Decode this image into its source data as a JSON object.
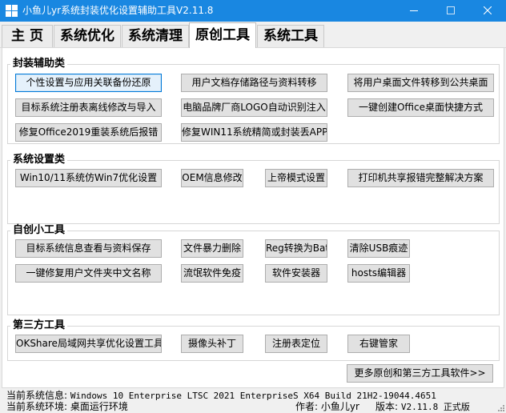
{
  "window": {
    "title": "小鱼儿yr系统封装优化设置辅助工具V2.11.8",
    "colors": {
      "titlebar": "#1987e1",
      "panel": "#ffffff",
      "button": "#e1e1e1",
      "focus": "#0078d7"
    }
  },
  "tabs": [
    {
      "label": "主 页",
      "active": false
    },
    {
      "label": "系统优化",
      "active": false
    },
    {
      "label": "系统清理",
      "active": false
    },
    {
      "label": "原创工具",
      "active": true
    },
    {
      "label": "系统工具",
      "active": false
    }
  ],
  "groups": {
    "packaging": {
      "title": "封装辅助类",
      "buttons": [
        "个性设置与应用关联备份还原",
        "用户文档存储路径与资料转移",
        "将用户桌面文件转移到公共桌面",
        "目标系统注册表离线修改与导入",
        "电脑品牌厂商LOGO自动识别注入",
        "一键创建Office桌面快捷方式",
        "修复Office2019重装系统后报错",
        "修复WIN11系统精简或封装丢APP"
      ]
    },
    "settings": {
      "title": "系统设置类",
      "buttons": [
        "Win10/11系统仿Win7优化设置",
        "OEM信息修改",
        "上帝模式设置",
        "打印机共享报错完整解决方案"
      ]
    },
    "tools": {
      "title": "自创小工具",
      "buttons": [
        "目标系统信息查看与资料保存",
        "文件暴力删除",
        "Reg转换为Bat",
        "清除USB痕迹",
        "一键修复用户文件夹中文名称",
        "流氓软件免疫",
        "软件安装器",
        "hosts编辑器"
      ]
    },
    "thirdparty": {
      "title": "第三方工具",
      "buttons": [
        "OKShare局域网共享优化设置工具",
        "摄像头补丁",
        "注册表定位",
        "右键管家"
      ]
    }
  },
  "more_button": "更多原创和第三方工具软件>>",
  "status": {
    "sysinfo_label": "当前系统信息:",
    "sysinfo_value": "Windows 10 Enterprise LTSC 2021 EnterpriseS X64 Build 21H2-19044.4651",
    "env_label": "当前系统环境:",
    "env_value": "桌面运行环境",
    "author_label": "作者:",
    "author_value": "小鱼儿yr",
    "version_label": "版本:",
    "version_value": "V2.11.8 正式版"
  }
}
